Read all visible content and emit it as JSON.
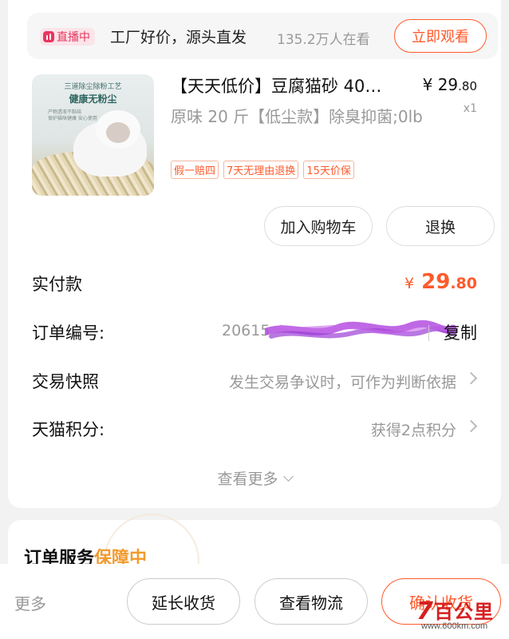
{
  "live": {
    "badge": "直播中",
    "title": "工厂好价，源头直发",
    "viewers": "135.2万人在看",
    "watch_button": "立即观看"
  },
  "product": {
    "thumbnail": {
      "top_text": "三道除尘除粉工艺",
      "main_text": "健康无粉尘",
      "sub_text_1": "产物透液不黏结",
      "sub_text_2": "保护猫咪健康 安心使用"
    },
    "title": "【天天低价】豆腐猫砂 40…",
    "price_currency": "¥",
    "price_int": "29",
    "price_dec": ".80",
    "quantity": "x1",
    "spec": "原味 20 斤【低尘款】除臭抑菌;0lb",
    "tags": [
      "假一赔四",
      "7天无理由退换",
      "15天价保"
    ],
    "add_to_cart_button": "加入购物车",
    "return_button": "退换"
  },
  "details": {
    "paid_label": "实付款",
    "paid_currency": "¥",
    "paid_int": "29",
    "paid_dec": ".80",
    "order_no_label": "订单编号:",
    "order_no_value": "20615",
    "copy_button": "复制",
    "snapshot_label": "交易快照",
    "snapshot_value": "发生交易争议时，可作为判断依据",
    "points_label": "天猫积分:",
    "points_value": "获得2点积分",
    "more_link": "查看更多"
  },
  "service": {
    "title": "订单服务",
    "badge": "保障中"
  },
  "bottom": {
    "more": "更多",
    "extend_button": "延长收货",
    "logistics_button": "查看物流",
    "confirm_button": "确认收货"
  },
  "watermark": {
    "logo_digit": "7",
    "text": "百公里",
    "url": "www.600km.com"
  },
  "colors": {
    "accent": "#ff5a2c",
    "live": "#e8365e",
    "guarantee": "#f29a2e",
    "redaction": "#b44de0"
  }
}
